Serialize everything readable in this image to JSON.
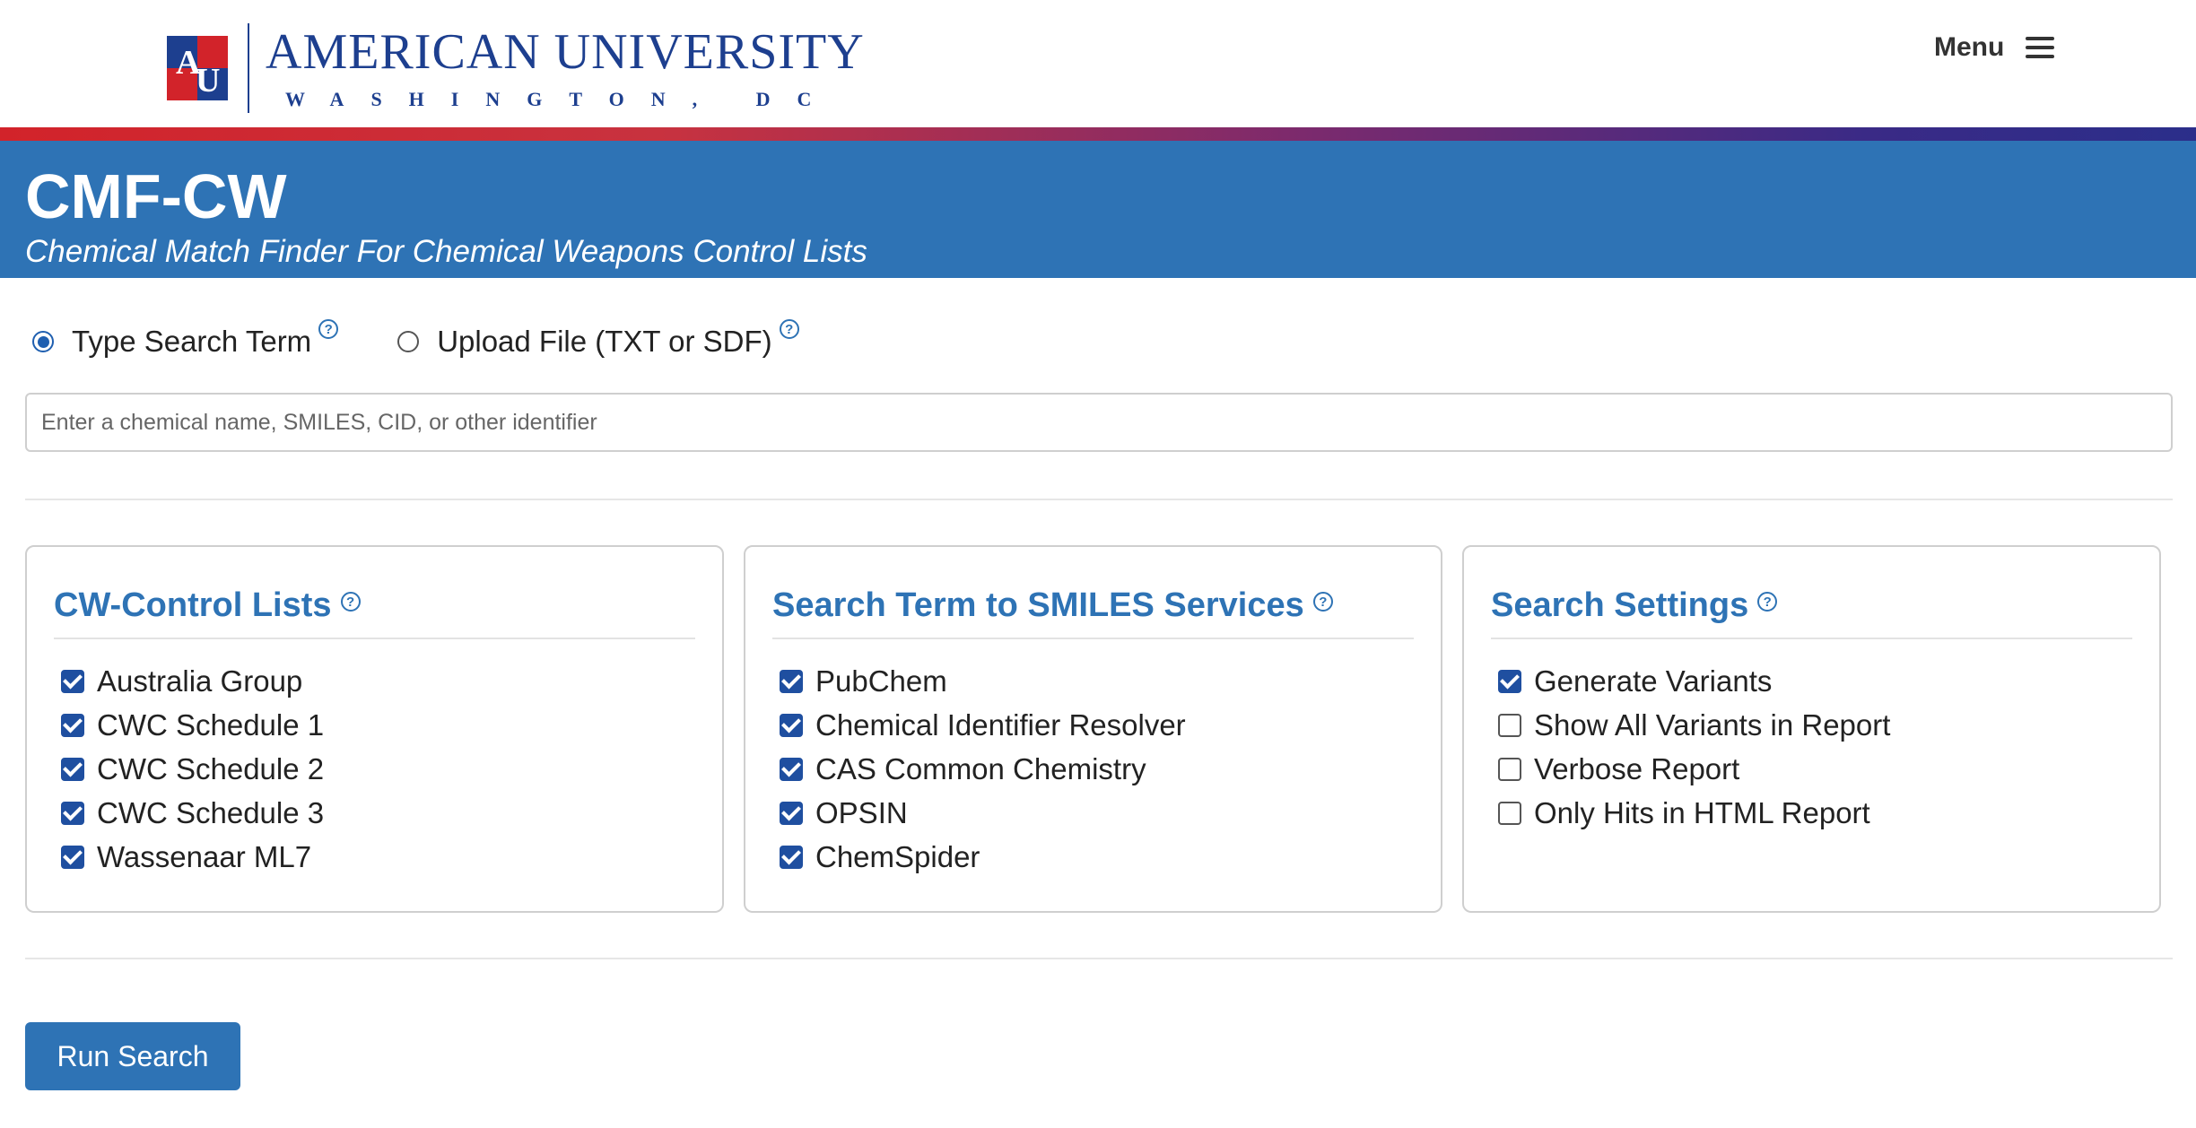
{
  "header": {
    "logo_title": "AMERICAN UNIVERSITY",
    "logo_sub": "WASHINGTON, DC",
    "logo_mark_icon": "au-monogram-icon",
    "menu_label": "Menu",
    "menu_icon": "hamburger-icon"
  },
  "banner": {
    "title": "CMF-CW",
    "subtitle": "Chemical Match Finder For Chemical Weapons Control Lists"
  },
  "search_mode": {
    "options": [
      {
        "label": "Type Search Term",
        "checked": true
      },
      {
        "label": "Upload File (TXT or SDF)",
        "checked": false
      }
    ],
    "help_glyph": "?"
  },
  "search": {
    "value": "",
    "placeholder": "Enter a chemical name, SMILES, CID, or other identifier"
  },
  "panels": {
    "control_lists": {
      "title": "CW-Control Lists",
      "items": [
        {
          "label": "Australia Group",
          "checked": true
        },
        {
          "label": "CWC Schedule 1",
          "checked": true
        },
        {
          "label": "CWC Schedule 2",
          "checked": true
        },
        {
          "label": "CWC Schedule 3",
          "checked": true
        },
        {
          "label": "Wassenaar ML7",
          "checked": true
        }
      ]
    },
    "smiles_services": {
      "title": "Search Term to SMILES Services",
      "items": [
        {
          "label": "PubChem",
          "checked": true
        },
        {
          "label": "Chemical Identifier Resolver",
          "checked": true
        },
        {
          "label": "CAS Common Chemistry",
          "checked": true
        },
        {
          "label": "OPSIN",
          "checked": true
        },
        {
          "label": "ChemSpider",
          "checked": true
        }
      ]
    },
    "search_settings": {
      "title": "Search Settings",
      "items": [
        {
          "label": "Generate Variants",
          "checked": true
        },
        {
          "label": "Show All Variants in Report",
          "checked": false
        },
        {
          "label": "Verbose Report",
          "checked": false
        },
        {
          "label": "Only Hits in HTML Report",
          "checked": false
        }
      ]
    }
  },
  "actions": {
    "run_label": "Run Search"
  },
  "colors": {
    "brand_blue": "#2e73b5",
    "au_navy": "#1d3f8f",
    "au_red": "#d2232a"
  }
}
